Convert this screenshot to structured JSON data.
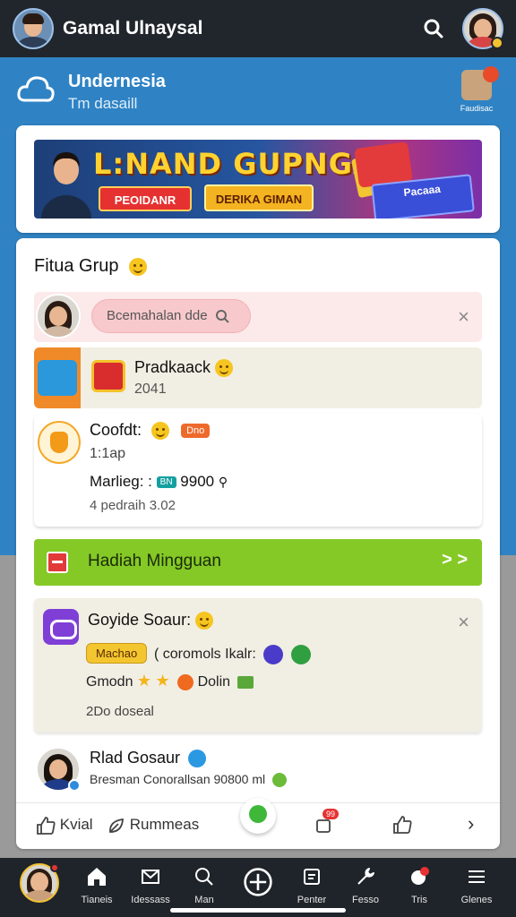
{
  "topbar": {
    "title": "Gamal Ulnaysal"
  },
  "header": {
    "title": "Undernesia",
    "subtitle": "Tm dasaill",
    "right_label": "Faudisac"
  },
  "banner": {
    "headline": "L:NAND GUPNGA",
    "button_primary": "PEOIDANR",
    "button_secondary": "DERIKA GIMAN",
    "side_promo": "Pacaaa"
  },
  "section": {
    "title": "Fitua Grup",
    "input_placeholder": "Bcemahalan dde",
    "app_item": {
      "title": "Pradkaack",
      "sub": "2041"
    },
    "goal_item": {
      "title": "Coofdt:",
      "tag": "Dno",
      "time": "1:1ap",
      "meta_label": "Marlieg: :",
      "meta_tag": "BN",
      "meta_value": "9900",
      "foot": "4 pedraih 3.02"
    },
    "green_banner": {
      "title": "Hadiah Mingguan"
    },
    "game_item": {
      "title": "Goyide Soaur:",
      "tag": "Machao",
      "line1": "( coromols Ikalr:",
      "line2a": "Gmodn",
      "line2b": "Dolin",
      "foot": "2Do doseal"
    },
    "friend_item": {
      "title": "Rlad Gosaur",
      "sub": "Bresman Conorallsan 90800 ml"
    }
  },
  "actions": {
    "like_label": "Kvial",
    "comment_label": "Rummeas",
    "badge": "99"
  },
  "bottom_nav": [
    {
      "label": "Tianeis"
    },
    {
      "label": "Idessass"
    },
    {
      "label": "Man"
    },
    {
      "label": ""
    },
    {
      "label": "Penter"
    },
    {
      "label": "Fesso"
    },
    {
      "label": "Tris"
    },
    {
      "label": "Glenes"
    }
  ],
  "colors": {
    "topbar": "#20262c",
    "primary_blue": "#2f83c4",
    "green": "#85c927",
    "accent_orange": "#ee6a2b"
  }
}
